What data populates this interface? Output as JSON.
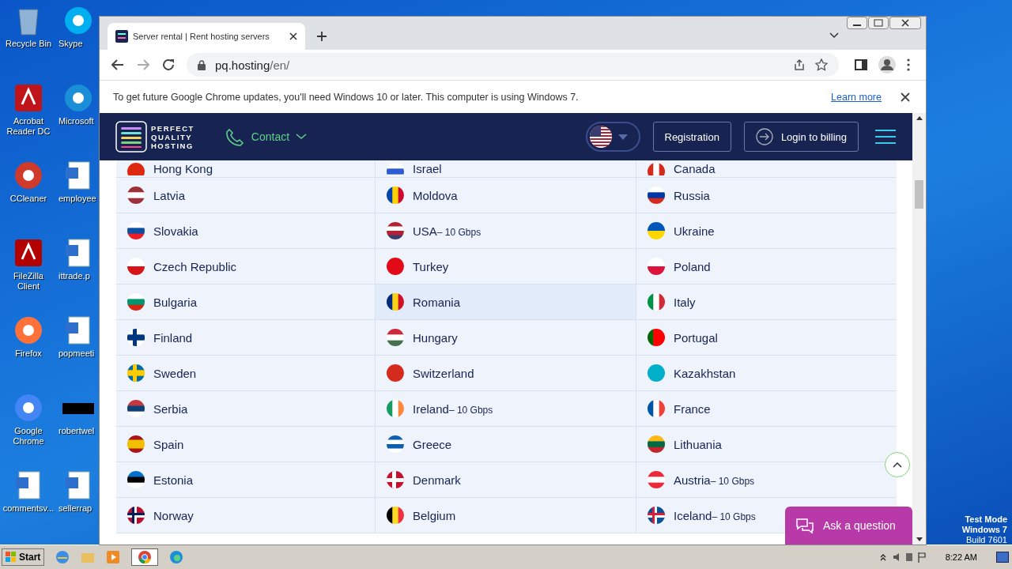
{
  "desktop": {
    "icons": [
      {
        "label": "Recycle Bin"
      },
      {
        "label": "Skype"
      },
      {
        "label": "Acrobat Reader DC"
      },
      {
        "label": "Microsoft"
      },
      {
        "label": "CCleaner"
      },
      {
        "label": "employee"
      },
      {
        "label": "FileZilla Client"
      },
      {
        "label": "ittrade.p"
      },
      {
        "label": "Firefox"
      },
      {
        "label": "popmeeti"
      },
      {
        "label": "Google Chrome"
      },
      {
        "label": "robertwel"
      },
      {
        "label": "commentsv..."
      },
      {
        "label": "sellerrap"
      }
    ],
    "test_mode": [
      "Test Mode",
      "Windows 7",
      "Build 7601"
    ]
  },
  "browser": {
    "tab": {
      "title": "Server rental | Rent hosting servers"
    },
    "address": {
      "host": "pq.hosting",
      "path": "/en/"
    },
    "infobar": {
      "text": "To get future Google Chrome updates, you'll need Windows 10 or later. This computer is using Windows 7.",
      "link": "Learn more"
    }
  },
  "site": {
    "logo": [
      "PERFECT",
      "QUALITY",
      "HOSTING"
    ],
    "contact": "Contact",
    "registration": "Registration",
    "login": "Login to billing",
    "countries": [
      {
        "name": "Hong Kong",
        "selected": false
      },
      {
        "name": "Israel",
        "selected": false
      },
      {
        "name": "Canada",
        "selected": false
      },
      {
        "name": "Latvia",
        "selected": false
      },
      {
        "name": "Moldova",
        "selected": false
      },
      {
        "name": "Russia",
        "selected": false
      },
      {
        "name": "Slovakia",
        "selected": false
      },
      {
        "name": "USA",
        "speed": "– 10 Gbps",
        "selected": false
      },
      {
        "name": "Ukraine",
        "selected": false
      },
      {
        "name": "Czech Republic",
        "selected": false
      },
      {
        "name": "Turkey",
        "selected": false
      },
      {
        "name": "Poland",
        "selected": false
      },
      {
        "name": "Bulgaria",
        "selected": false
      },
      {
        "name": "Romania",
        "selected": true
      },
      {
        "name": "Italy",
        "selected": false
      },
      {
        "name": "Finland",
        "selected": false
      },
      {
        "name": "Hungary",
        "selected": false
      },
      {
        "name": "Portugal",
        "selected": false
      },
      {
        "name": "Sweden",
        "selected": false
      },
      {
        "name": "Switzerland",
        "selected": false
      },
      {
        "name": "Kazakhstan",
        "selected": false
      },
      {
        "name": "Serbia",
        "selected": false
      },
      {
        "name": "Ireland",
        "speed": "– 10 Gbps",
        "selected": false
      },
      {
        "name": "France",
        "selected": false
      },
      {
        "name": "Spain",
        "selected": false
      },
      {
        "name": "Greece",
        "selected": false
      },
      {
        "name": "Lithuania",
        "selected": false
      },
      {
        "name": "Estonia",
        "selected": false
      },
      {
        "name": "Denmark",
        "selected": false
      },
      {
        "name": "Austria",
        "speed": "– 10 Gbps",
        "selected": false
      },
      {
        "name": "Norway",
        "selected": false
      },
      {
        "name": "Belgium",
        "selected": false
      },
      {
        "name": "Iceland",
        "speed": "– 10 Gbps",
        "selected": false
      }
    ],
    "chat": "Ask a question"
  },
  "taskbar": {
    "start": "Start",
    "time": "8:22 AM"
  }
}
